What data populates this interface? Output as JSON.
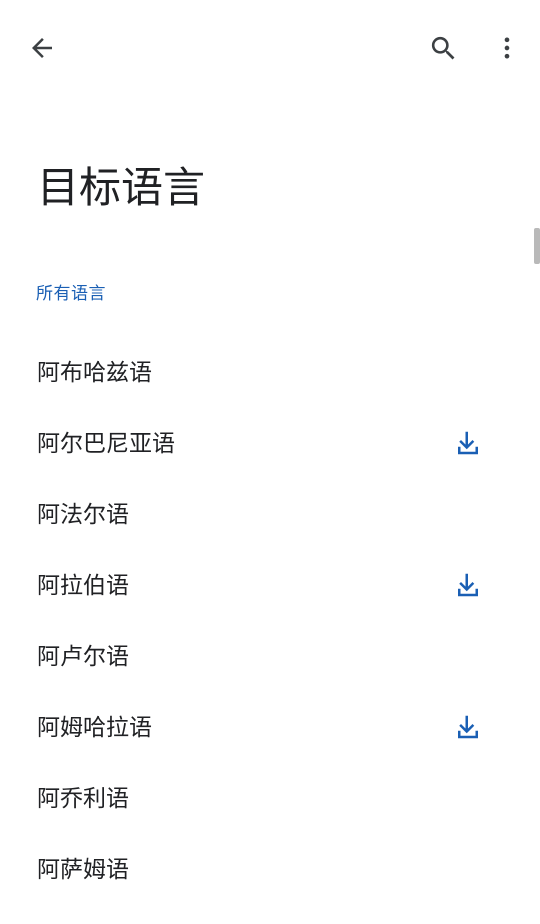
{
  "toolbar": {
    "back_icon": "arrow-back-icon",
    "search_icon": "search-icon",
    "more_icon": "more-vert-icon"
  },
  "page": {
    "title": "目标语言"
  },
  "section": {
    "label": "所有语言"
  },
  "languages": [
    {
      "name": "阿布哈兹语",
      "downloadable": false
    },
    {
      "name": "阿尔巴尼亚语",
      "downloadable": true
    },
    {
      "name": "阿法尔语",
      "downloadable": false
    },
    {
      "name": "阿拉伯语",
      "downloadable": true
    },
    {
      "name": "阿卢尔语",
      "downloadable": false
    },
    {
      "name": "阿姆哈拉语",
      "downloadable": true
    },
    {
      "name": "阿乔利语",
      "downloadable": false
    },
    {
      "name": "阿萨姆语",
      "downloadable": false
    }
  ],
  "colors": {
    "accent": "#1a5fb4",
    "text_primary": "#202124",
    "icon_gray": "#5f6368",
    "scroll_thumb": "#b9b9b9",
    "background": "#ffffff"
  }
}
